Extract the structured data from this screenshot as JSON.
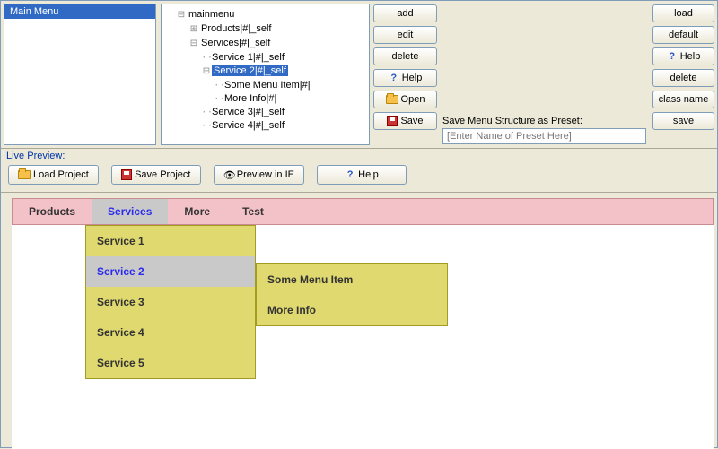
{
  "leftPaneTitle": "Main Menu",
  "tree": {
    "root": "mainmenu",
    "n_products": "Products|#|_self",
    "n_services": "Services|#|_self",
    "n_s1": "Service 1|#|_self",
    "n_s2": "Service 2|#|_self",
    "n_s2_a": "Some Menu Item|#|",
    "n_s2_b": "More Info|#|",
    "n_s3": "Service 3|#|_self",
    "n_s4": "Service 4|#|_self"
  },
  "buttonsCol1": {
    "add": "add",
    "edit": "edit",
    "delete": "delete",
    "help": "Help",
    "open": "Open",
    "save": "Save"
  },
  "preset": {
    "label": "Save Menu Structure as Preset:",
    "placeholder": "[Enter Name of Preset Here]"
  },
  "buttonsRight": {
    "load": "load",
    "default": "default",
    "help": "Help",
    "delete": "delete",
    "classname": "class name",
    "save": "save"
  },
  "livePreview": "Live Preview:",
  "toolbar2": {
    "loadProject": "Load Project",
    "saveProject": "Save Project",
    "previewIE": "Preview in IE",
    "help": "Help"
  },
  "previewMenuBar": {
    "products": "Products",
    "services": "Services",
    "more": "More",
    "test": "Test"
  },
  "previewSubmenu": {
    "s1": "Service 1",
    "s2": "Service 2",
    "s3": "Service 3",
    "s4": "Service 4",
    "s5": "Service 5"
  },
  "previewSubmenu2": {
    "a": "Some Menu Item",
    "b": "More Info"
  }
}
